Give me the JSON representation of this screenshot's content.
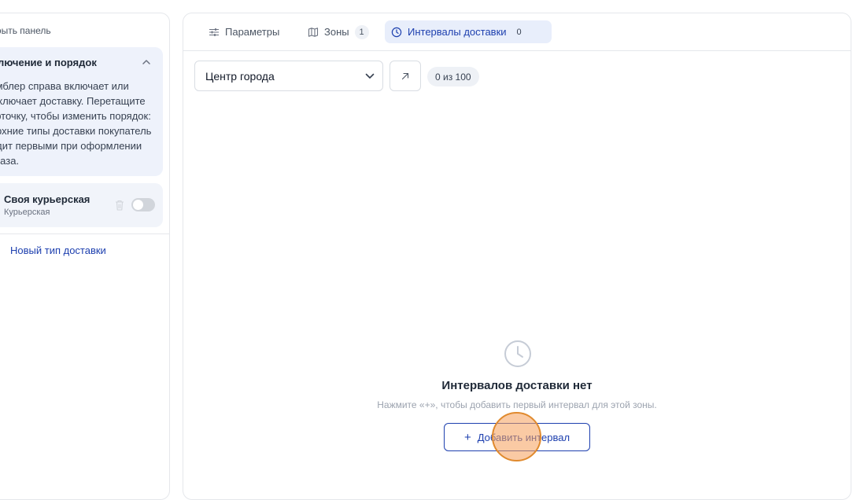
{
  "sidebar": {
    "collapse_label": "Скрыть панель",
    "info": {
      "title": "Включение и порядок",
      "body": "Тумблер справа включает или выключает доставку. Перетащите карточку, чтобы изменить порядок: верхние типы доставки покупатель видит первыми при оформлении заказа."
    },
    "delivery_type": {
      "name": "Своя курьерская",
      "subtitle": "Курьерская",
      "enabled": false
    },
    "new_type_label": "Новый тип доставки"
  },
  "tabs": [
    {
      "label": "Параметры",
      "icon": "sliders-icon",
      "count": null
    },
    {
      "label": "Зоны",
      "icon": "map-icon",
      "count": "1"
    },
    {
      "label": "Интервалы доставки",
      "icon": "clock-icon",
      "count": "0",
      "active": true
    }
  ],
  "zone_select": {
    "value": "Центр города"
  },
  "quota": "0 из 100",
  "empty_state": {
    "title": "Интервалов доставки нет",
    "description": "Нажмите «+», чтобы добавить первый интервал для этой зоны.",
    "button_label": "Добавить интервал"
  },
  "colors": {
    "accent": "#1e40af",
    "active_tab_bg": "#e8eefb",
    "info_card_bg": "#eef2fb",
    "cursor_highlight": "#f59e5a"
  }
}
